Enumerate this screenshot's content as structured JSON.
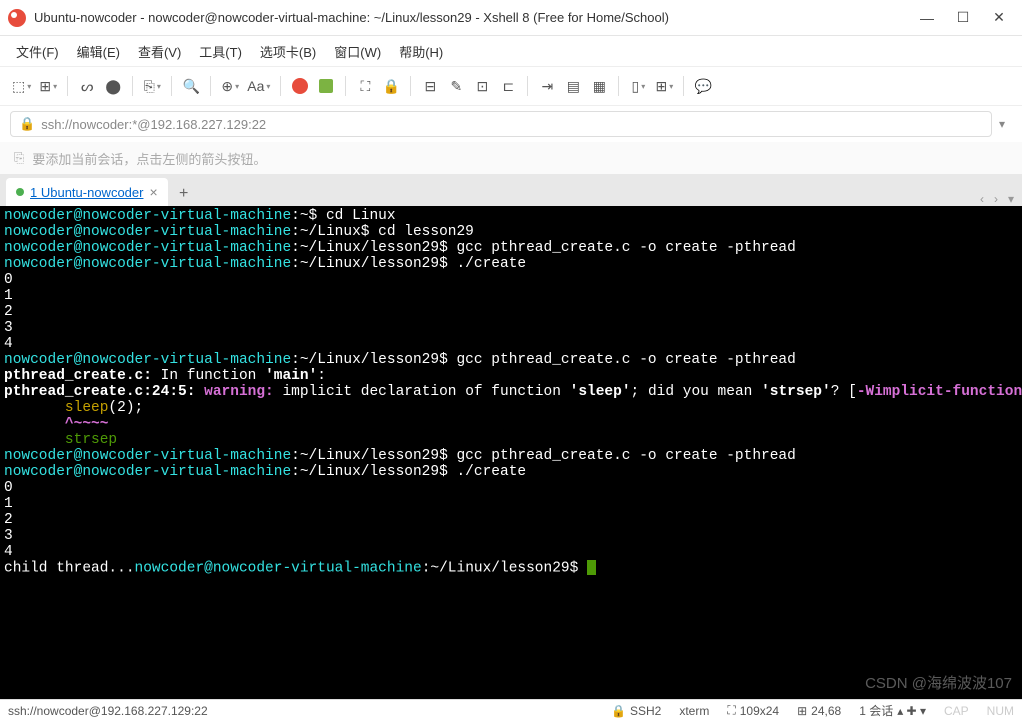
{
  "window": {
    "title": "Ubuntu-nowcoder - nowcoder@nowcoder-virtual-machine: ~/Linux/lesson29 - Xshell 8 (Free for Home/School)"
  },
  "menu": {
    "file": "文件(F)",
    "edit": "编辑(E)",
    "view": "查看(V)",
    "tools": "工具(T)",
    "tabs": "选项卡(B)",
    "window": "窗口(W)",
    "help": "帮助(H)"
  },
  "toolbar": {
    "font_label": "Aa"
  },
  "address": {
    "url": "ssh://nowcoder:*@192.168.227.129:22"
  },
  "hint": {
    "text": "要添加当前会话，点击左侧的箭头按钮。"
  },
  "tab": {
    "label": "1 Ubuntu-nowcoder"
  },
  "terminal": {
    "prompt_user": "nowcoder@nowcoder-virtual-machine",
    "p_home": ":~$ ",
    "p_linux": ":~/Linux$ ",
    "p_lesson": ":~/Linux/lesson29$ ",
    "cmd1": "cd Linux",
    "cmd2": "cd lesson29",
    "cmd3": "gcc pthread_create.c -o create -pthread",
    "cmd4": "./create",
    "n0": "0",
    "n1": "1",
    "n2": "2",
    "n3": "3",
    "n4": "4",
    "warn1a": "pthread_create.c:",
    "warn1b": " In function ",
    "warn1c": "'main'",
    "warn1d": ":",
    "warn2a": "pthread_create.c:24:5:",
    "warn2b": " warning:",
    "warn2c": " implicit declaration of function ",
    "warn2d": "'sleep'",
    "warn2e": "; did you mean ",
    "warn2f": "'strsep'",
    "warn2g": "? [",
    "warn2h": "-Wimplicit-function-declaration",
    "warn2i": "]",
    "code1a": "       sleep",
    "code1b": "(2);",
    "code2": "       ^~~~~",
    "code3": "       strsep",
    "child": "child thread..."
  },
  "status": {
    "conn": "ssh://nowcoder@192.168.227.129:22",
    "proto": "SSH2",
    "term": "xterm",
    "size": "109x24",
    "pos": "24,68",
    "sess": "1 会话",
    "cap": "CAP",
    "num": "NUM"
  },
  "watermark": "CSDN @海绵波波107"
}
